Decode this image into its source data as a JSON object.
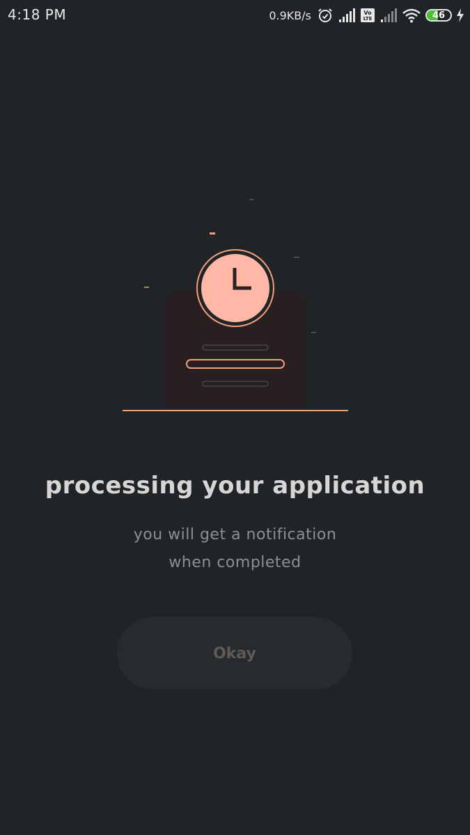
{
  "status_bar": {
    "time": "4:18 PM",
    "net_speed": "0.9KB/s",
    "volte_label": "Vo LTE",
    "battery_level": "46",
    "icons": [
      "alarm-icon",
      "signal-icon",
      "volte-icon",
      "signal-weak-icon",
      "wifi-icon",
      "battery-icon",
      "charging-icon"
    ]
  },
  "main": {
    "title": "processing your application",
    "subtitle_line1": "you will get a notification",
    "subtitle_line2": "when completed",
    "okay_label": "Okay"
  },
  "colors": {
    "background": "#212427",
    "accent": "#f2a07b",
    "clock_face": "#ffb8a6",
    "button": "#282b2d",
    "button_text": "#5f5a55",
    "battery": "#4cc03a"
  }
}
